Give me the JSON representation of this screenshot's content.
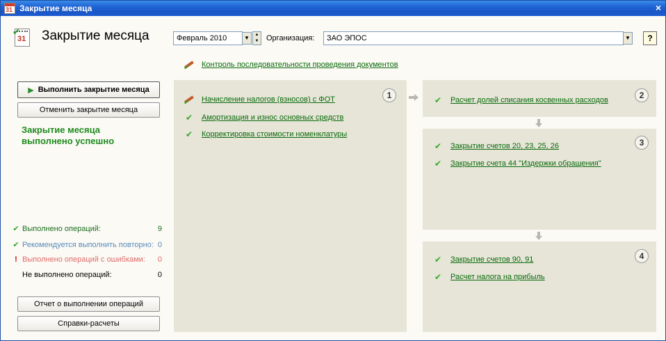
{
  "window": {
    "title": "Закрытие месяца",
    "close_glyph": "×"
  },
  "header": {
    "title": "Закрытие месяца",
    "calendar_number": "31",
    "period": "Февраль 2010",
    "org_label": "Организация:",
    "org_value": "ЗАО ЭПОС",
    "help": "?"
  },
  "control_link": "Контроль последовательности проведения документов",
  "left": {
    "run_button": "Выполнить закрытие месяца",
    "cancel_button": "Отменить закрытие месяца",
    "status_line1": "Закрытие месяца",
    "status_line2": "выполнено успешно",
    "stats": [
      {
        "label": "Выполнено операций:",
        "value": "9",
        "color": "#1e6e1e",
        "icon": "check-icon"
      },
      {
        "label": "Рекомендуется выполнить повторно:",
        "value": "0",
        "color": "#5a8ab8",
        "icon": "check-icon"
      },
      {
        "label": "Выполнено операций с ошибками:",
        "value": "0",
        "color": "#e06a6a",
        "icon": "exclamation-icon"
      },
      {
        "label": "Не выполнено операций:",
        "value": "0",
        "color": "#000000",
        "icon": "none"
      }
    ],
    "report_button": "Отчет о выполнении операций",
    "calc_button": "Справки-расчеты"
  },
  "panel1": {
    "number": "1",
    "items": [
      "Начисление налогов (взносов) с ФОТ",
      "Амортизация и износ основных средств",
      "Корректировка стоимости номенклатуры"
    ]
  },
  "panel2": {
    "number": "2",
    "items": [
      "Расчет долей списания косвенных расходов"
    ]
  },
  "panel3": {
    "number": "3",
    "items": [
      "Закрытие счетов 20, 23, 25, 26",
      "Закрытие счета 44 \"Издержки обращения\""
    ]
  },
  "panel4": {
    "number": "4",
    "items": [
      "Закрытие счетов 90, 91",
      "Расчет налога на прибыль"
    ]
  },
  "colors": {
    "link": "#0a6a0a",
    "check": "#35a82b",
    "panel_bg": "#e6e5d8",
    "success": "#1e8a1e"
  }
}
